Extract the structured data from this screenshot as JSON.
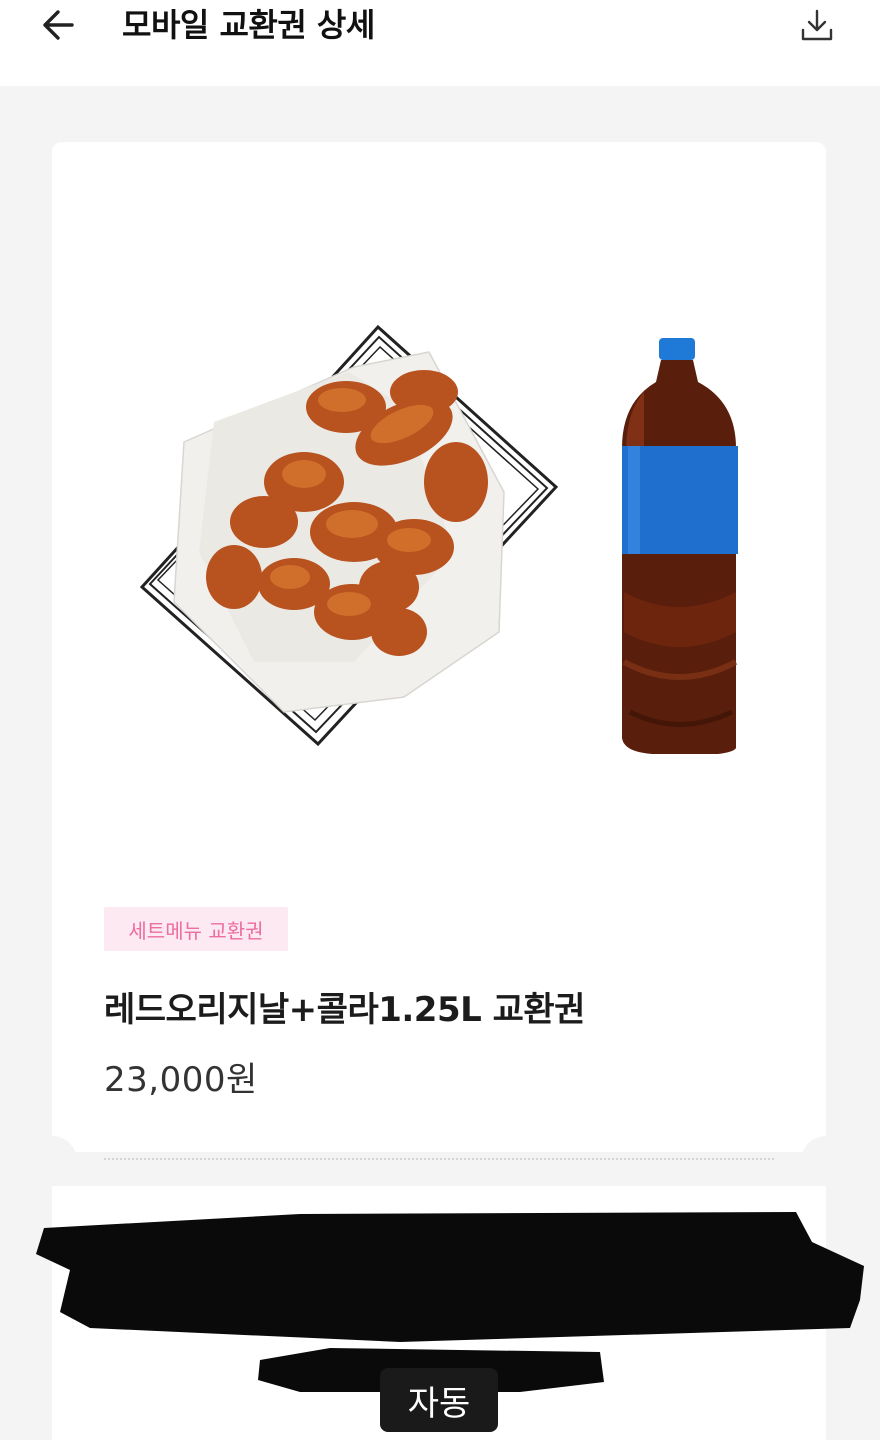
{
  "header": {
    "title": "모바일 교환권 상세"
  },
  "product": {
    "category": "세트메뉴 교환권",
    "name": "레드오리지날+콜라1.25L 교환권",
    "price": "23,000원"
  },
  "overlay": {
    "auto_label": "자동"
  },
  "colors": {
    "badge_bg": "#fde9f1",
    "badge_text": "#ec6da0",
    "cola_label": "#1f6fcf"
  }
}
